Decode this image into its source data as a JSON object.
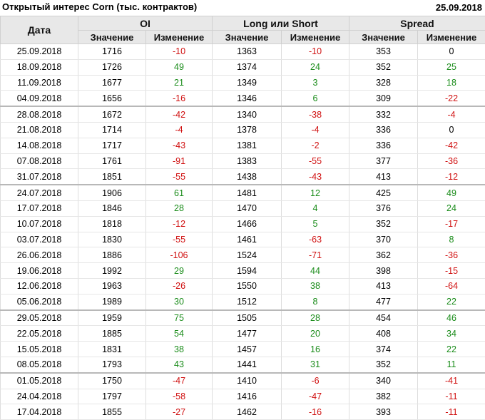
{
  "title": "Открытый интерес Corn (тыс. контрактов)",
  "date": "25.09.2018",
  "headers": {
    "date": "Дата",
    "groups": [
      "OI",
      "Long или Short",
      "Spread"
    ],
    "value": "Значение",
    "change": "Изменение"
  },
  "colors": {
    "positive": "#1a8c1a",
    "negative": "#d01010",
    "header_bg": "#e8e8e8"
  },
  "rows": [
    [
      "25.09.2018",
      1716,
      -10,
      1363,
      -10,
      353,
      0
    ],
    [
      "18.09.2018",
      1726,
      49,
      1374,
      24,
      352,
      25
    ],
    [
      "11.09.2018",
      1677,
      21,
      1349,
      3,
      328,
      18
    ],
    [
      "04.09.2018",
      1656,
      -16,
      1346,
      6,
      309,
      -22
    ],
    [
      "28.08.2018",
      1672,
      -42,
      1340,
      -38,
      332,
      -4
    ],
    [
      "21.08.2018",
      1714,
      -4,
      1378,
      -4,
      336,
      0
    ],
    [
      "14.08.2018",
      1717,
      -43,
      1381,
      -2,
      336,
      -42
    ],
    [
      "07.08.2018",
      1761,
      -91,
      1383,
      -55,
      377,
      -36
    ],
    [
      "31.07.2018",
      1851,
      -55,
      1438,
      -43,
      413,
      -12
    ],
    [
      "24.07.2018",
      1906,
      61,
      1481,
      12,
      425,
      49
    ],
    [
      "17.07.2018",
      1846,
      28,
      1470,
      4,
      376,
      24
    ],
    [
      "10.07.2018",
      1818,
      -12,
      1466,
      5,
      352,
      -17
    ],
    [
      "03.07.2018",
      1830,
      -55,
      1461,
      -63,
      370,
      8
    ],
    [
      "26.06.2018",
      1886,
      -106,
      1524,
      -71,
      362,
      -36
    ],
    [
      "19.06.2018",
      1992,
      29,
      1594,
      44,
      398,
      -15
    ],
    [
      "12.06.2018",
      1963,
      -26,
      1550,
      38,
      413,
      -64
    ],
    [
      "05.06.2018",
      1989,
      30,
      1512,
      8,
      477,
      22
    ],
    [
      "29.05.2018",
      1959,
      75,
      1505,
      28,
      454,
      46
    ],
    [
      "22.05.2018",
      1885,
      54,
      1477,
      20,
      408,
      34
    ],
    [
      "15.05.2018",
      1831,
      38,
      1457,
      16,
      374,
      22
    ],
    [
      "08.05.2018",
      1793,
      43,
      1441,
      31,
      352,
      11
    ],
    [
      "01.05.2018",
      1750,
      -47,
      1410,
      -6,
      340,
      -41
    ],
    [
      "24.04.2018",
      1797,
      -58,
      1416,
      -47,
      382,
      -11
    ],
    [
      "17.04.2018",
      1855,
      -27,
      1462,
      -16,
      393,
      -11
    ]
  ],
  "month_breaks": [
    4,
    9,
    17,
    21
  ]
}
